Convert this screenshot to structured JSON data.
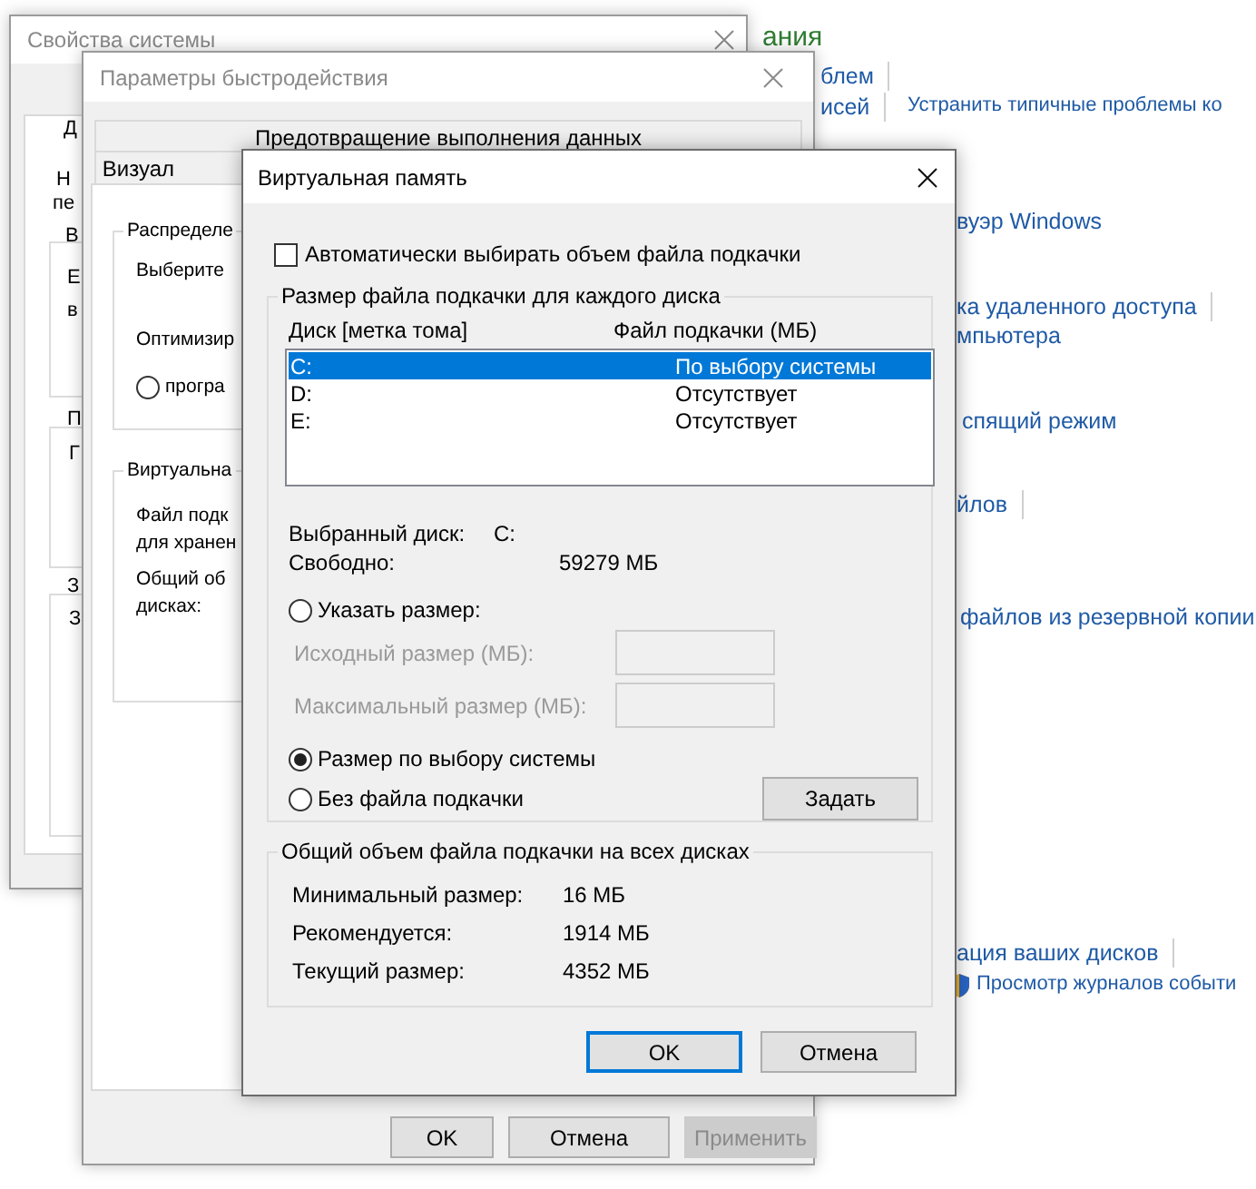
{
  "control_panel": {
    "heading": "ания",
    "links": [
      {
        "text": "блем",
        "separator": true,
        "shield": false
      },
      {
        "text": "исей",
        "separator": true,
        "shield": false
      },
      {
        "text": "Устранить типичные проблемы ко",
        "separator": false,
        "shield": false
      },
      {
        "text": "вуэр Windows",
        "separator": false,
        "shield": false
      },
      {
        "text": "ка удаленного доступа",
        "separator": true,
        "shield": false
      },
      {
        "text": "мпьютера",
        "separator": false,
        "shield": false
      },
      {
        "text": "спящий режим",
        "separator": false,
        "shield": false
      },
      {
        "text": "йлов",
        "separator": true,
        "shield": false
      },
      {
        "text": "файлов из резервной копии",
        "separator": false,
        "shield": false
      },
      {
        "text": "ация ваших дисков",
        "separator": true,
        "shield": false
      },
      {
        "text": "Просмотр журналов событи",
        "separator": false,
        "shield": true
      }
    ]
  },
  "system_properties": {
    "title": "Свойства системы",
    "fragments": [
      "Д",
      "Н",
      "пе",
      "В",
      "Е",
      "в",
      "П",
      "Г",
      "З",
      "З"
    ]
  },
  "performance_options": {
    "title": "Параметры быстродействия",
    "tabs": [
      {
        "label": "Предотвращение выполнения данных",
        "selected": false
      },
      {
        "label": "Визуал",
        "selected": false
      }
    ],
    "groups": [
      {
        "legend": "Распределе",
        "items": [
          {
            "kind": "text",
            "text": "Выберите"
          },
          {
            "kind": "text",
            "text": "Оптимизир"
          },
          {
            "kind": "radio",
            "text": "програ",
            "selected": false
          }
        ]
      },
      {
        "legend": "Виртуальна",
        "items": [
          {
            "kind": "text",
            "text": "Файл подк"
          },
          {
            "kind": "text",
            "text": "для хранен"
          },
          {
            "kind": "text",
            "text": "Общий об"
          },
          {
            "kind": "text",
            "text": "дисках:"
          }
        ]
      }
    ],
    "buttons": [
      {
        "label": "OK",
        "disabled": false
      },
      {
        "label": "Отмена",
        "disabled": false
      },
      {
        "label": "Применить",
        "disabled": true
      }
    ]
  },
  "virtual_memory": {
    "title": "Виртуальная память",
    "auto_manage": {
      "label": "Автоматически выбирать объем файла подкачки",
      "checked": false
    },
    "per_drive": {
      "legend": "Размер файла подкачки для каждого диска",
      "columns": [
        "Диск [метка тома]",
        "Файл подкачки (МБ)"
      ],
      "drives": [
        {
          "drive": "C:",
          "paging_file": "По выбору системы",
          "selected": true
        },
        {
          "drive": "D:",
          "paging_file": "Отсутствует",
          "selected": false
        },
        {
          "drive": "E:",
          "paging_file": "Отсутствует",
          "selected": false
        }
      ],
      "selected_drive_label": "Выбранный диск:",
      "selected_drive": "C:",
      "free_label": "Свободно:",
      "free": "59279 МБ",
      "options": [
        {
          "label": "Указать размер:",
          "selected": false
        },
        {
          "label": "Размер по выбору системы",
          "selected": true
        },
        {
          "label": "Без файла подкачки",
          "selected": false
        }
      ],
      "initial_size_label": "Исходный размер (МБ):",
      "max_size_label": "Максимальный размер (МБ):",
      "fields_disabled": true,
      "set_button": "Задать"
    },
    "totals": {
      "legend": "Общий объем файла подкачки на всех дисках",
      "rows": [
        {
          "label": "Минимальный размер:",
          "value": "16 МБ"
        },
        {
          "label": "Рекомендуется:",
          "value": "1914 МБ"
        },
        {
          "label": "Текущий размер:",
          "value": "4352 МБ"
        }
      ]
    },
    "buttons": [
      {
        "label": "OK",
        "default": true
      },
      {
        "label": "Отмена",
        "default": false
      }
    ]
  }
}
